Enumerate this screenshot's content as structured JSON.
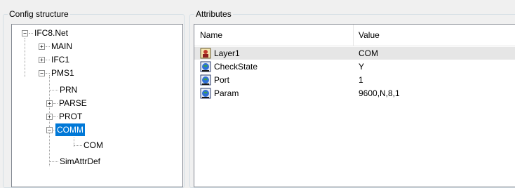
{
  "config_group": {
    "title": "Config structure"
  },
  "attributes_group": {
    "title": "Attributes"
  },
  "tree": {
    "root": "IFC8.Net",
    "main": "MAIN",
    "ifc1": "IFC1",
    "pms1": "PMS1",
    "prn": "PRN",
    "parse": "PARSE",
    "prot": "PROT",
    "comm": "COMM",
    "com": "COM",
    "simattrdef": "SimAttrDef",
    "selected": "COMM"
  },
  "attributes": {
    "columns": {
      "name": "Name",
      "value": "Value"
    },
    "rows": [
      {
        "name": "Layer1",
        "value": "COM",
        "icon": "user-icon"
      },
      {
        "name": "CheckState",
        "value": "Y",
        "icon": "globe-icon"
      },
      {
        "name": "Port",
        "value": "1",
        "icon": "globe-icon"
      },
      {
        "name": "Param",
        "value": "9600,N,8,1",
        "icon": "globe-icon"
      }
    ]
  },
  "colors": {
    "selection": "#0078d7",
    "row_highlight": "#e6e6e6"
  }
}
